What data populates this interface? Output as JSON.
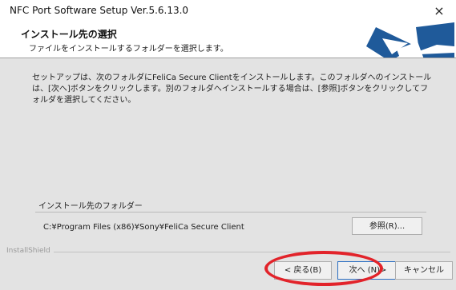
{
  "window": {
    "title": "NFC Port Software Setup  Ver.5.6.13.0",
    "close_glyph": "×"
  },
  "header": {
    "title": "インストール先の選択",
    "subtitle": "ファイルをインストールするフォルダーを選択します。"
  },
  "body": {
    "description": "セットアップは、次のフォルダにFeliCa Secure Clientをインストールします。このフォルダへのインストールは、[次へ]ボタンをクリックします。別のフォルダへインストールする場合は、[参照]ボタンをクリックしてフォルダを選択してください。",
    "group_label": "インストール先のフォルダー",
    "path": "C:¥Program Files (x86)¥Sony¥FeliCa Secure Client",
    "browse_label": "参照(R)..."
  },
  "footer": {
    "brand": "InstallShield",
    "back_label": "< 戻る(B)",
    "next_label": "次へ (N)>",
    "cancel_label": "キャンセル"
  },
  "colors": {
    "accent": "#2b6fc2",
    "logo_blue": "#1f5a9a",
    "highlight_circle": "#e2232a"
  }
}
